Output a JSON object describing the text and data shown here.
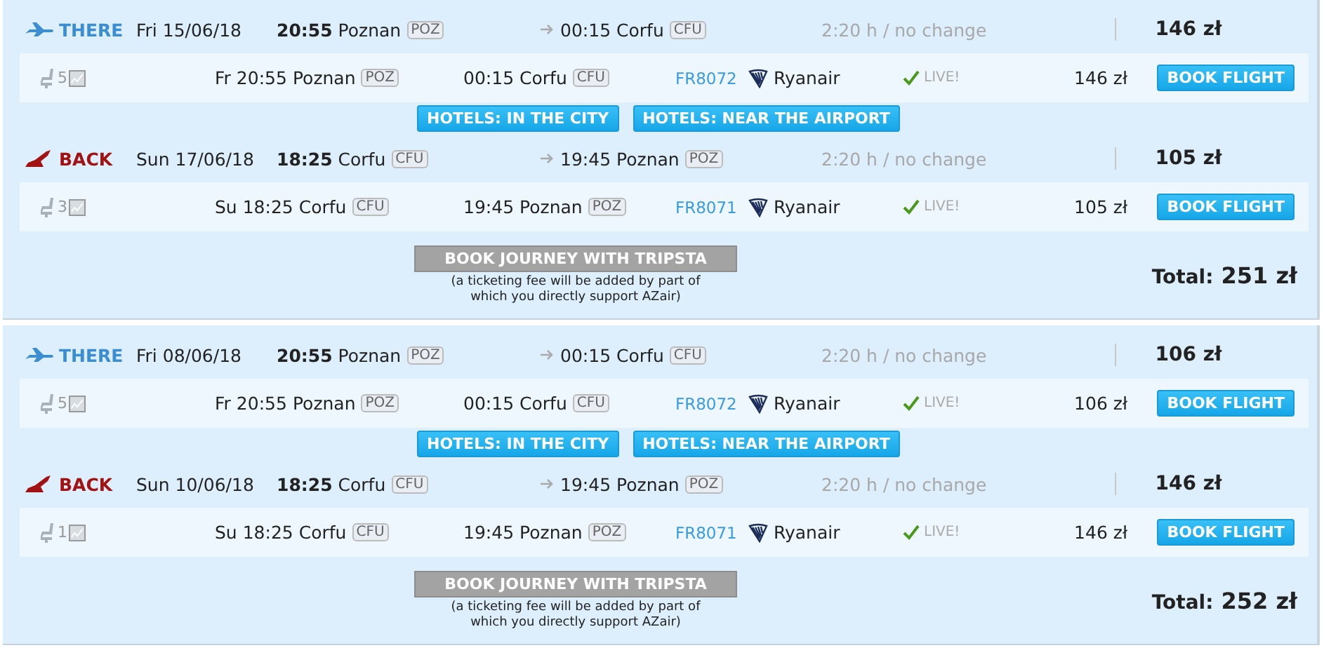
{
  "trips": [
    {
      "legs": [
        {
          "direction": "THERE",
          "kind": "there",
          "date": "Fri 15/06/18",
          "dep_time": "20:55",
          "dep_city": "Poznan",
          "dep_code": "POZ",
          "arr_time": "00:15",
          "arr_city": "Corfu",
          "arr_code": "CFU",
          "duration": "2:20 h / no change",
          "price": "146 zł",
          "detail": {
            "seats": "5",
            "day": "Fr",
            "dep_time": "20:55",
            "dep_city": "Poznan",
            "dep_code": "POZ",
            "arr_time": "00:15",
            "arr_city": "Corfu",
            "arr_code": "CFU",
            "flight": "FR8072",
            "airline": "Ryanair",
            "status": "LIVE!",
            "price": "146 zł",
            "button": "BOOK FLIGHT"
          }
        },
        {
          "direction": "BACK",
          "kind": "back",
          "date": "Sun 17/06/18",
          "dep_time": "18:25",
          "dep_city": "Corfu",
          "dep_code": "CFU",
          "arr_time": "19:45",
          "arr_city": "Poznan",
          "arr_code": "POZ",
          "duration": "2:20 h / no change",
          "price": "105 zł",
          "detail": {
            "seats": "3",
            "day": "Su",
            "dep_time": "18:25",
            "dep_city": "Corfu",
            "dep_code": "CFU",
            "arr_time": "19:45",
            "arr_city": "Poznan",
            "arr_code": "POZ",
            "flight": "FR8071",
            "airline": "Ryanair",
            "status": "LIVE!",
            "price": "105 zł",
            "button": "BOOK FLIGHT"
          }
        }
      ],
      "hotels": [
        "HOTELS: IN THE CITY",
        "HOTELS: NEAR THE AIRPORT"
      ],
      "book_button": "BOOK JOURNEY WITH TRIPSTA",
      "fee_note": "(a ticketing fee will be added by part of which you directly support AZair)",
      "total_label": "Total:",
      "total": "251 zł"
    },
    {
      "legs": [
        {
          "direction": "THERE",
          "kind": "there",
          "date": "Fri 08/06/18",
          "dep_time": "20:55",
          "dep_city": "Poznan",
          "dep_code": "POZ",
          "arr_time": "00:15",
          "arr_city": "Corfu",
          "arr_code": "CFU",
          "duration": "2:20 h / no change",
          "price": "106 zł",
          "detail": {
            "seats": "5",
            "day": "Fr",
            "dep_time": "20:55",
            "dep_city": "Poznan",
            "dep_code": "POZ",
            "arr_time": "00:15",
            "arr_city": "Corfu",
            "arr_code": "CFU",
            "flight": "FR8072",
            "airline": "Ryanair",
            "status": "LIVE!",
            "price": "106 zł",
            "button": "BOOK FLIGHT"
          }
        },
        {
          "direction": "BACK",
          "kind": "back",
          "date": "Sun 10/06/18",
          "dep_time": "18:25",
          "dep_city": "Corfu",
          "dep_code": "CFU",
          "arr_time": "19:45",
          "arr_city": "Poznan",
          "arr_code": "POZ",
          "duration": "2:20 h / no change",
          "price": "146 zł",
          "detail": {
            "seats": "1",
            "day": "Su",
            "dep_time": "18:25",
            "dep_city": "Corfu",
            "dep_code": "CFU",
            "arr_time": "19:45",
            "arr_city": "Poznan",
            "arr_code": "POZ",
            "flight": "FR8071",
            "airline": "Ryanair",
            "status": "LIVE!",
            "price": "146 zł",
            "button": "BOOK FLIGHT"
          }
        }
      ],
      "hotels": [
        "HOTELS: IN THE CITY",
        "HOTELS: NEAR THE AIRPORT"
      ],
      "book_button": "BOOK JOURNEY WITH TRIPSTA",
      "fee_note": "(a ticketing fee will be added by part of which you directly support AZair)",
      "total_label": "Total:",
      "total": "252 zł"
    }
  ]
}
